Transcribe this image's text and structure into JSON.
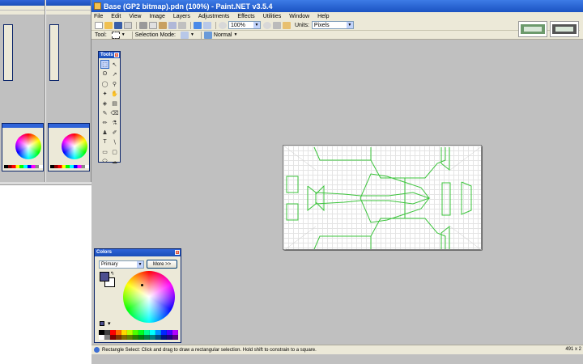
{
  "window": {
    "title": "Base (GP2 bitmap).pdn (100%) - Paint.NET v3.5.4"
  },
  "menu": [
    "File",
    "Edit",
    "View",
    "Image",
    "Layers",
    "Adjustments",
    "Effects",
    "Utilities",
    "Window",
    "Help"
  ],
  "toolbar": {
    "zoom": "100%",
    "units_label": "Units:",
    "units_value": "Pixels"
  },
  "toolbar2": {
    "tool_label": "Tool:",
    "selection_mode_label": "Selection Mode:",
    "blend_mode": "Normal"
  },
  "tools_panel": {
    "title": "Tools",
    "tools": [
      {
        "name": "rectangle-select",
        "glyph": "⬚",
        "active": true
      },
      {
        "name": "move-selected",
        "glyph": "↖"
      },
      {
        "name": "lasso-select",
        "glyph": "ʘ"
      },
      {
        "name": "move-selection",
        "glyph": "↗"
      },
      {
        "name": "ellipse-select",
        "glyph": "◯"
      },
      {
        "name": "zoom",
        "glyph": "⚲"
      },
      {
        "name": "magic-wand",
        "glyph": "✦"
      },
      {
        "name": "pan",
        "glyph": "✋"
      },
      {
        "name": "paint-bucket",
        "glyph": "◈"
      },
      {
        "name": "gradient",
        "glyph": "▤"
      },
      {
        "name": "paintbrush",
        "glyph": "✎"
      },
      {
        "name": "eraser",
        "glyph": "⌫"
      },
      {
        "name": "pencil",
        "glyph": "✏"
      },
      {
        "name": "color-picker",
        "glyph": "⚗"
      },
      {
        "name": "clone-stamp",
        "glyph": "♟"
      },
      {
        "name": "recolor",
        "glyph": "✐"
      },
      {
        "name": "text",
        "glyph": "T"
      },
      {
        "name": "line-curve",
        "glyph": "∖"
      },
      {
        "name": "rectangle",
        "glyph": "▭"
      },
      {
        "name": "rounded-rectangle",
        "glyph": "▢"
      },
      {
        "name": "ellipse",
        "glyph": "⬭"
      },
      {
        "name": "freeform-shape",
        "glyph": "☁"
      }
    ]
  },
  "colors_panel": {
    "title": "Colors",
    "mode": "Primary",
    "more_button": "More >>",
    "primary_color": "#4d4f8f",
    "secondary_color": "#ffffff",
    "palette": [
      "#000000",
      "#404040",
      "#ff0000",
      "#ff6a00",
      "#ffd800",
      "#b6ff00",
      "#4cff00",
      "#00ff21",
      "#00ff90",
      "#00ffff",
      "#0094ff",
      "#0026ff",
      "#4800ff",
      "#b200ff",
      "#ffffff",
      "#808080",
      "#7f0000",
      "#7f3300",
      "#7f6a00",
      "#5b7f00",
      "#267f00",
      "#007f0e",
      "#007f46",
      "#007f7f",
      "#004a7f",
      "#00137f",
      "#21007f",
      "#57007f"
    ]
  },
  "status": {
    "text": "Rectangle Select: Click and drag to draw a rectangular selection. Hold shift to constrain to a square.",
    "size": "491 x 2"
  },
  "canvas": {
    "outline_color": "#3cc43c"
  }
}
